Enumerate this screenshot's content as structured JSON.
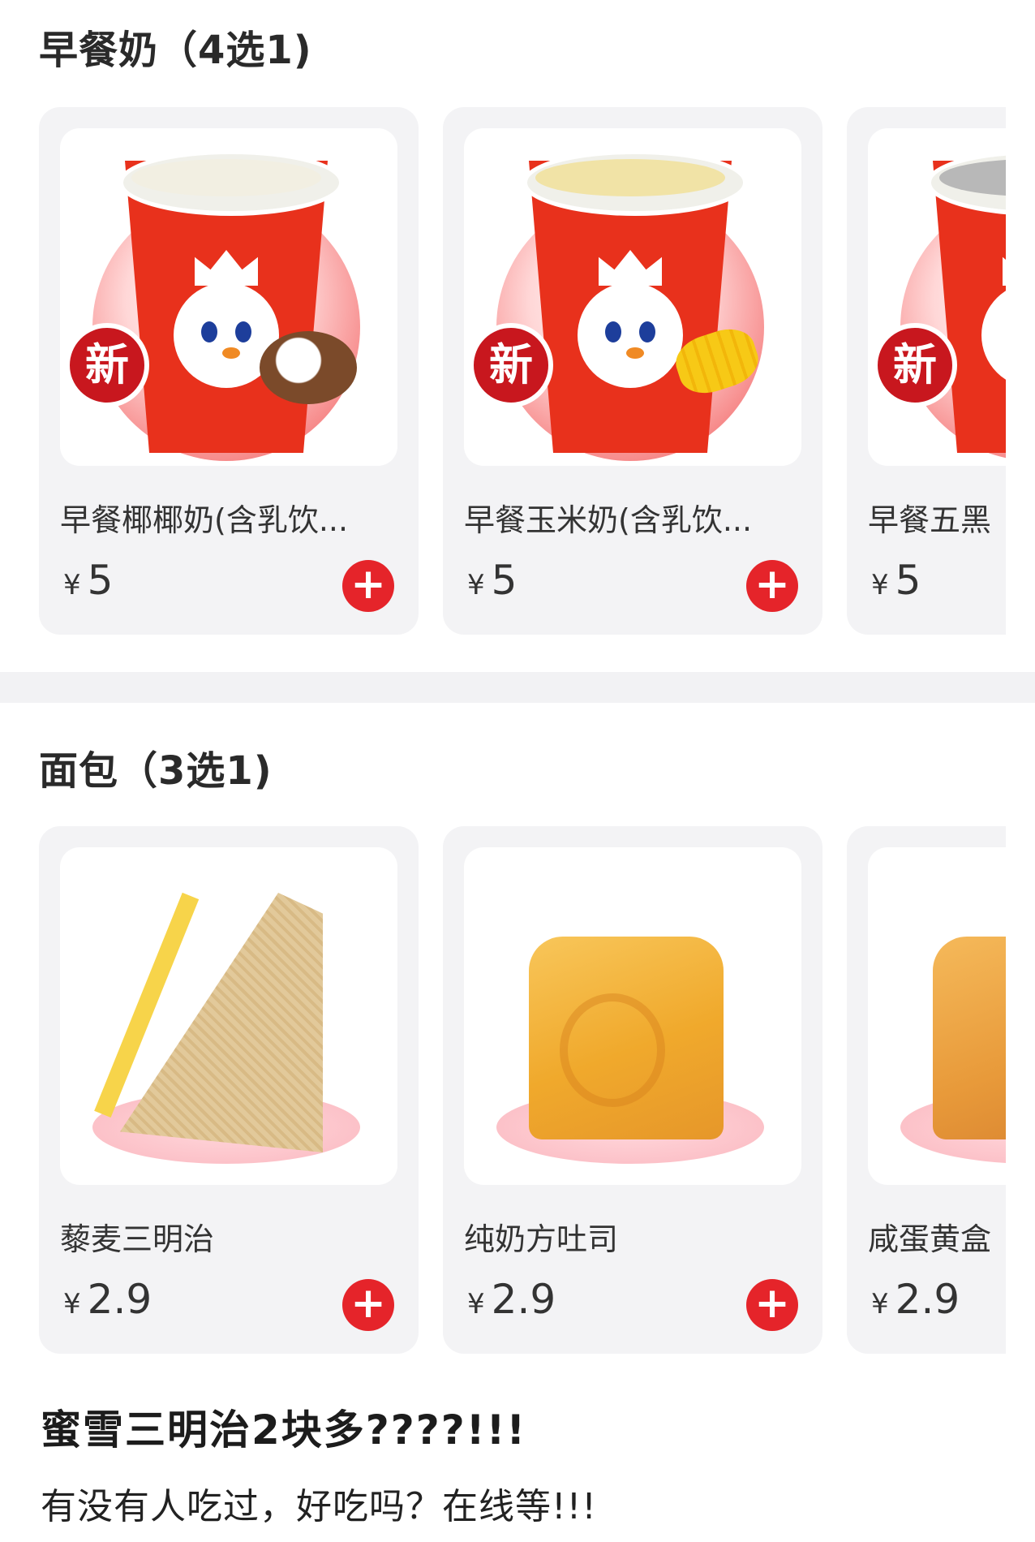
{
  "sections": [
    {
      "title": "早餐奶（4选1)",
      "items": [
        {
          "name": "早餐椰椰奶(含乳饮...",
          "currency": "¥",
          "price": "5",
          "badge": "新",
          "add_label": "+",
          "drink_color": "#f2efe2",
          "garnish": "coconut-icon"
        },
        {
          "name": "早餐玉米奶(含乳饮...",
          "currency": "¥",
          "price": "5",
          "badge": "新",
          "add_label": "+",
          "drink_color": "#f1e3a6",
          "garnish": "corn-icon"
        },
        {
          "name": "早餐五黑",
          "currency": "¥",
          "price": "5",
          "badge": "新",
          "add_label": "+",
          "drink_color": "#b8b8b8",
          "garnish": "none"
        }
      ]
    },
    {
      "title": "面包（3选1)",
      "items": [
        {
          "name": "藜麦三明治",
          "currency": "¥",
          "price": "2.9",
          "add_label": "+"
        },
        {
          "name": "纯奶方吐司",
          "currency": "¥",
          "price": "2.9",
          "add_label": "+"
        },
        {
          "name": "咸蛋黄盒",
          "currency": "¥",
          "price": "2.9",
          "add_label": "+"
        }
      ]
    }
  ],
  "post": {
    "title": "蜜雪三明治2块多????!!!",
    "body": "有没有人吃过，好吃吗？在线等!!!"
  },
  "colors": {
    "accent_red": "#e5242a",
    "card_bg": "#f3f3f5",
    "badge_red": "#c8171e"
  }
}
